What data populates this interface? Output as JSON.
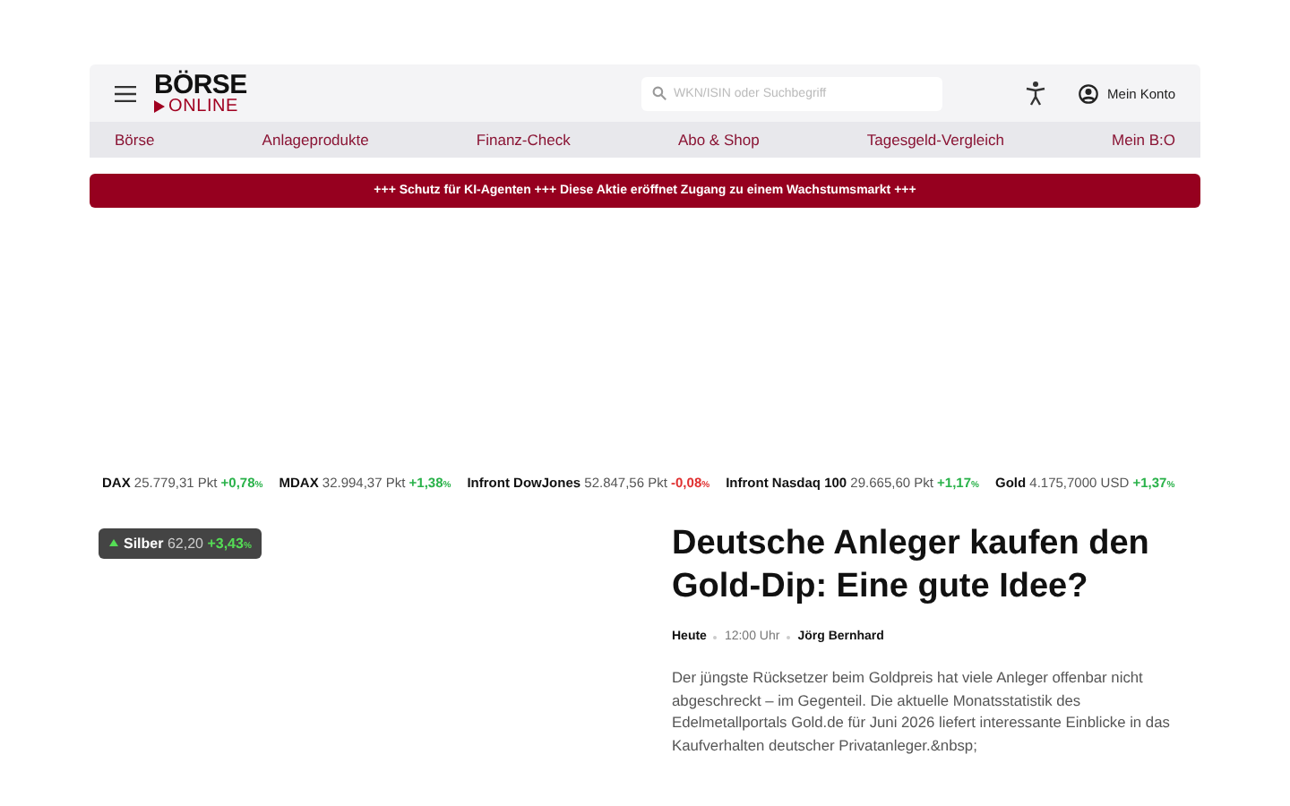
{
  "header": {
    "logo_top": "BÖRSE",
    "logo_bottom": "ONLINE",
    "search": {
      "placeholder": "WKN/ISIN oder Suchbegriff"
    },
    "account": "Mein Konto"
  },
  "nav": [
    "Börse",
    "Anlageprodukte",
    "Finanz-Check",
    "Abo & Shop",
    "Tagesgeld-Vergleich",
    "Mein B:O"
  ],
  "banner": "+++ Schutz für KI-Agenten +++ Diese Aktie eröffnet Zugang zu einem Wachstumsmarkt +++",
  "tickers": [
    {
      "name": "DAX",
      "value": "25.779,31 Pkt",
      "change": "+0,78",
      "unit": "%",
      "color": "#2ab24a"
    },
    {
      "name": "MDAX",
      "value": "32.994,37 Pkt",
      "change": "+1,38",
      "unit": "%",
      "color": "#2ab24a"
    },
    {
      "name": "Infront DowJones",
      "value": "52.847,56 Pkt",
      "change": "-0,08",
      "unit": "%",
      "color": "#e03030"
    },
    {
      "name": "Infront Nasdaq 100",
      "value": "29.665,60 Pkt",
      "change": "+1,17",
      "unit": "%",
      "color": "#2ab24a"
    },
    {
      "name": "Gold",
      "value": "4.175,7000 USD",
      "change": "+1,37",
      "unit": "%",
      "color": "#2ab24a"
    }
  ],
  "badge": {
    "name": "Silber",
    "value": "62,20",
    "change": "+3,43",
    "unit": "%",
    "color": "#55dd55"
  },
  "article": {
    "title": "Deutsche Anleger kaufen den Gold-Dip: Eine gute Idee?",
    "date": "Heute",
    "time": "12:00 Uhr",
    "author": "Jörg Bernhard",
    "teaser": "Der jüngste Rücksetzer beim Goldpreis hat viele Anleger offenbar nicht abgeschreckt – im Gegenteil. Die aktuelle Monatsstatistik des Edelmetallportals Gold.de für Juni 2026 liefert interessante Einblicke in das Kaufverhalten deutscher Privatanleger.&nbsp;"
  }
}
